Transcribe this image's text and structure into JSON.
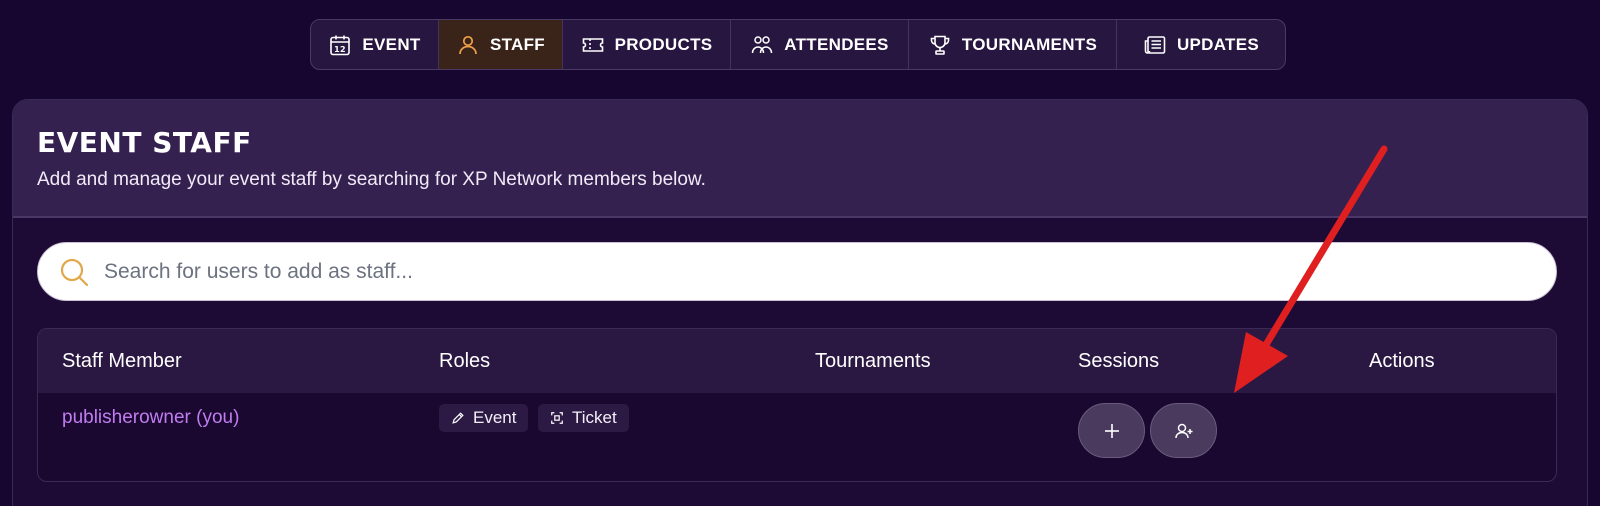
{
  "tabs": [
    {
      "label": "EVENT",
      "icon": "calendar-icon",
      "active": false
    },
    {
      "label": "STAFF",
      "icon": "user-icon",
      "active": true
    },
    {
      "label": "PRODUCTS",
      "icon": "ticket-icon",
      "active": false
    },
    {
      "label": "ATTENDEES",
      "icon": "users-icon",
      "active": false
    },
    {
      "label": "TOURNAMENTS",
      "icon": "trophy-icon",
      "active": false
    },
    {
      "label": "UPDATES",
      "icon": "newspaper-icon",
      "active": false
    }
  ],
  "calendar_icon_day": "12",
  "card": {
    "title": "EVENT STAFF",
    "subtitle": "Add and manage your event staff by searching for XP Network members below."
  },
  "search": {
    "placeholder": "Search for users to add as staff...",
    "value": ""
  },
  "table": {
    "columns": {
      "staff_member": "Staff Member",
      "roles": "Roles",
      "tournaments": "Tournaments",
      "sessions": "Sessions",
      "actions": "Actions"
    },
    "rows": [
      {
        "name": "publisherowner (you)",
        "roles": [
          {
            "label": "Event",
            "icon": "pencil-icon"
          },
          {
            "label": "Ticket",
            "icon": "scan-icon"
          }
        ],
        "session_buttons": [
          {
            "icon": "plus-icon"
          },
          {
            "icon": "add-user-icon"
          }
        ]
      }
    ]
  },
  "colors": {
    "background": "#17062f",
    "accent_orange": "#f0a048",
    "staff_name": "#c07cf0",
    "annotation_arrow": "#e02020"
  }
}
